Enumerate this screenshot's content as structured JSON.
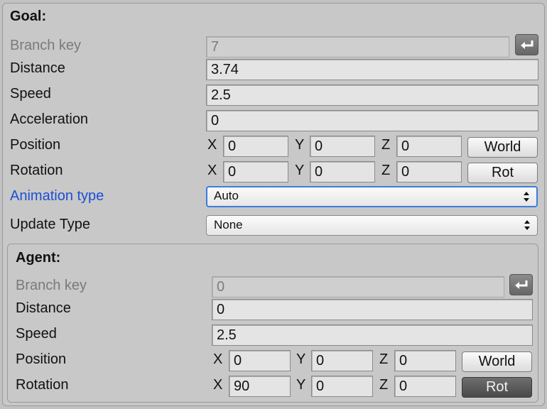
{
  "goal": {
    "header": "Goal:",
    "branch_key": {
      "label": "Branch key",
      "value": "7"
    },
    "distance": {
      "label": "Distance",
      "value": "3.74"
    },
    "speed": {
      "label": "Speed",
      "value": "2.5"
    },
    "acceleration": {
      "label": "Acceleration",
      "value": "0"
    },
    "position": {
      "label": "Position",
      "x_label": "X",
      "x": "0",
      "y_label": "Y",
      "y": "0",
      "z_label": "Z",
      "z": "0",
      "button": "World"
    },
    "rotation": {
      "label": "Rotation",
      "x_label": "X",
      "x": "0",
      "y_label": "Y",
      "y": "0",
      "z_label": "Z",
      "z": "0",
      "button": "Rot"
    },
    "animation_type": {
      "label": "Animation type",
      "value": "Auto"
    },
    "update_type": {
      "label": "Update Type",
      "value": "None"
    }
  },
  "agent": {
    "header": "Agent:",
    "branch_key": {
      "label": "Branch key",
      "value": "0"
    },
    "distance": {
      "label": "Distance",
      "value": "0"
    },
    "speed": {
      "label": "Speed",
      "value": "2.5"
    },
    "position": {
      "label": "Position",
      "x_label": "X",
      "x": "0",
      "y_label": "Y",
      "y": "0",
      "z_label": "Z",
      "z": "0",
      "button": "World"
    },
    "rotation": {
      "label": "Rotation",
      "x_label": "X",
      "x": "90",
      "y_label": "Y",
      "y": "0",
      "z_label": "Z",
      "z": "0",
      "button": "Rot"
    }
  },
  "colors": {
    "focus_label": "#1a4fd6",
    "focus_border": "#3b7de0",
    "toggle_on": "#555555"
  },
  "icons": {
    "enter": "return-arrow-icon",
    "select_caret": "up-down-caret-icon"
  }
}
